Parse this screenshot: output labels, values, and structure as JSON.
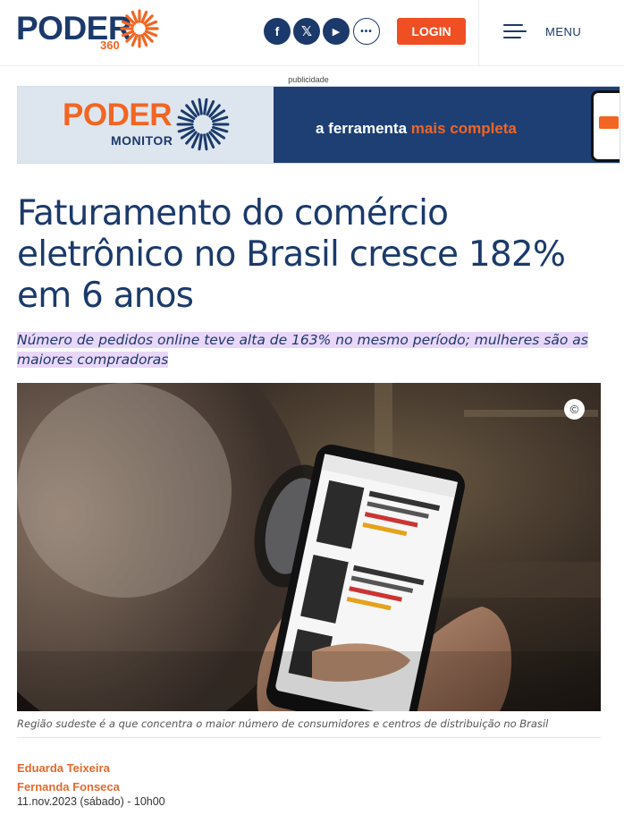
{
  "header": {
    "logo_word": "PODER",
    "logo_number": "360",
    "social": [
      {
        "name": "facebook",
        "glyph": "f"
      },
      {
        "name": "x",
        "glyph": "𝕏"
      },
      {
        "name": "youtube",
        "glyph": "▶"
      },
      {
        "name": "more",
        "glyph": "•••"
      }
    ],
    "login_label": "LOGIN",
    "menu_label": "MENU",
    "brand_colors": {
      "navy": "#1b3a6b",
      "orange": "#f26522"
    }
  },
  "ad": {
    "label": "publicidade",
    "brand_top": "PODER",
    "brand_bottom": "MONITOR",
    "tagline_start": "a ferramenta ",
    "tagline_highlight": "mais completa"
  },
  "article": {
    "title": "Faturamento do comércio eletrônico no Brasil cresce 182% em 6 anos",
    "subtitle": "Número de pedidos online teve alta de 163% no mesmo período; mulheres são as maiores compradoras",
    "photo_copyright": "©",
    "caption": "Região sudeste é a que concentra o maior número de consumidores e centros de distribuição no Brasil",
    "authors": [
      "Eduarda Teixeira",
      "Fernanda Fonseca"
    ],
    "date": "11.nov.2023 (sábado) - 10h00"
  }
}
